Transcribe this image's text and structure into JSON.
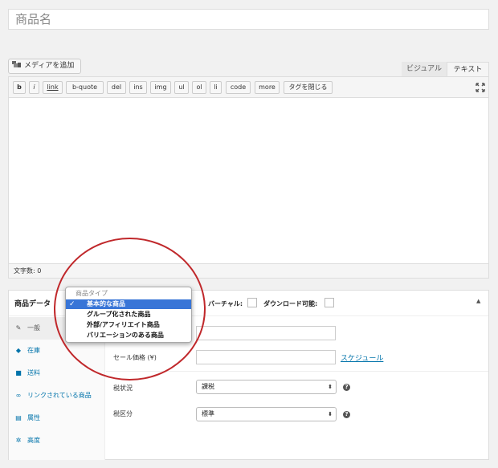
{
  "editor": {
    "title_placeholder": "商品名",
    "media_button": "メディアを追加",
    "tabs": {
      "visual": "ビジュアル",
      "text": "テキスト"
    },
    "quicktags": [
      "b",
      "i",
      "link",
      "b-quote",
      "del",
      "ins",
      "img",
      "ul",
      "ol",
      "li",
      "code",
      "more",
      "タグを閉じる"
    ],
    "word_count": "文字数: 0"
  },
  "product_data": {
    "title": "商品データ",
    "virtual_label": "バーチャル:",
    "downloadable_label": "ダウンロード可能:",
    "tabs": [
      {
        "label": "一般",
        "icon": "wrench-icon"
      },
      {
        "label": "在庫",
        "icon": "tag-icon"
      },
      {
        "label": "送料",
        "icon": "truck-icon"
      },
      {
        "label": "リンクされている商品",
        "icon": "link-icon"
      },
      {
        "label": "属性",
        "icon": "list-icon"
      },
      {
        "label": "高度",
        "icon": "gear-icon"
      }
    ],
    "sale_price_label": "セール価格 (¥)",
    "schedule_link": "スケジュール",
    "tax_status_label": "税状況",
    "tax_status_value": "課税",
    "tax_class_label": "税区分",
    "tax_class_value": "標準"
  },
  "product_type_dropdown": {
    "heading": "商品タイプ",
    "options": [
      "基本的な商品",
      "グループ化された商品",
      "外部/アフィリエイト商品",
      "バリエーションのある商品"
    ],
    "selected": "基本的な商品"
  },
  "colors": {
    "accent": "#0073aa",
    "selection": "#3875d7",
    "highlight_circle": "#c0282b"
  }
}
